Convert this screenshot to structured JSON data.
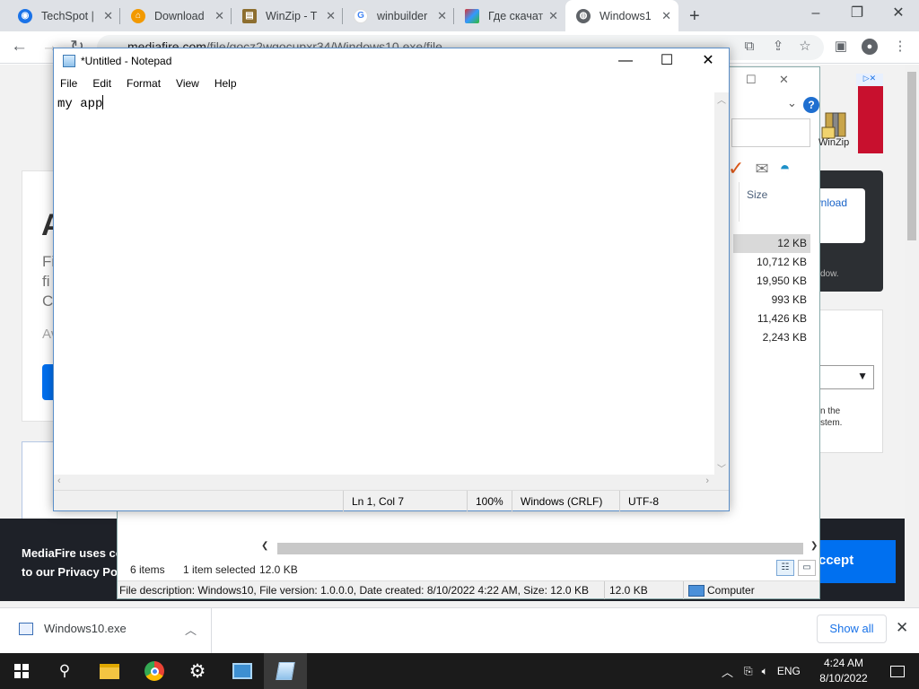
{
  "browser": {
    "tabs": [
      {
        "title": "TechSpot |",
        "icon": "techspot-icon",
        "color": "#1a73e8"
      },
      {
        "title": "Download",
        "icon": "download-site-icon",
        "color": "#f29900"
      },
      {
        "title": "WinZip - T",
        "icon": "winzip-icon",
        "color": "#8d6e2f"
      },
      {
        "title": "winbuilder",
        "icon": "google-icon",
        "color": "#4285f4"
      },
      {
        "title": "Где скачат",
        "icon": "image-site-icon",
        "color": "#d33"
      },
      {
        "title": "Windows1",
        "icon": "globe-icon",
        "color": "#5f6368"
      }
    ],
    "new_tab": "+",
    "url_domain": "mediafire.com",
    "url_path": "/file/gocz2wgocupxr34/Windows10.exe/file"
  },
  "mediafire": {
    "heading_partial": "A",
    "gray_lines": [
      "Fi",
      "fi",
      "C"
    ],
    "gray_line4": "Av",
    "download_btn_partial": "wnload",
    "dark_note_partial": "dow.",
    "small_lines": [
      "n the",
      "stem."
    ],
    "cookie_line1": "MediaFire uses co",
    "cookie_line2": "to our Privacy Poli",
    "accept_partial": "ccept",
    "ad_badge": "▷✕"
  },
  "explorer": {
    "column_size": "Size",
    "sizes": [
      "12 KB",
      "10,712 KB",
      "19,950 KB",
      "993 KB",
      "11,426 KB",
      "2,243 KB"
    ],
    "items_count": "6 items",
    "selected": "1 item selected",
    "selected_size": "12.0 KB",
    "description": "File description: Windows10, File version: 1.0.0.0, Date created: 8/10/2022 4:22 AM, Size: 12.0 KB",
    "desc_size": "12.0 KB",
    "desc_location": "Computer",
    "winzip_label": "WinZip"
  },
  "notepad": {
    "title": "*Untitled - Notepad",
    "menu": [
      "File",
      "Edit",
      "Format",
      "View",
      "Help"
    ],
    "content": "my app",
    "status": {
      "position": "Ln 1, Col 7",
      "zoom": "100%",
      "line_ending": "Windows (CRLF)",
      "encoding": "UTF-8"
    }
  },
  "downloads": {
    "file_name": "Windows10.exe",
    "show_all": "Show all"
  },
  "taskbar": {
    "language": "ENG",
    "time": "4:24 AM",
    "date": "8/10/2022"
  }
}
